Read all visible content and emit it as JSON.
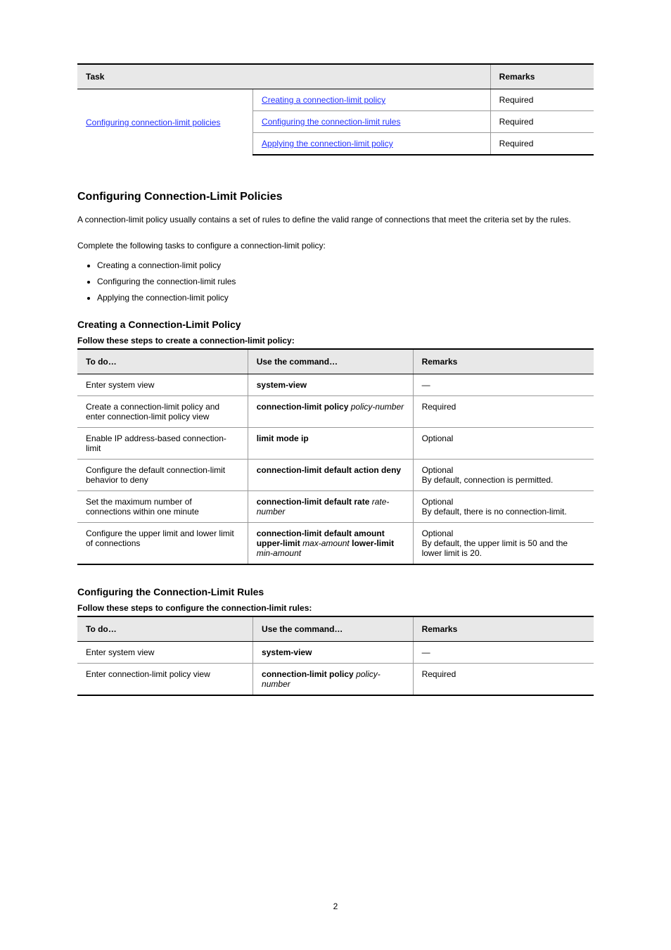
{
  "page_number": "2",
  "table1": {
    "header_left": "Task",
    "header_right": "Remarks",
    "merged_left": "Configuring connection-limit policies",
    "rows": [
      {
        "link": "Creating a connection-limit policy",
        "remarks": "Required"
      },
      {
        "link": "Configuring the connection-limit rules",
        "remarks": "Required"
      },
      {
        "link": "Applying the connection-limit policy",
        "remarks": "Required"
      }
    ]
  },
  "section1": {
    "title": "Configuring Connection-Limit Policies",
    "lead": "A connection-limit policy usually contains a set of rules to define the valid range of connections that meet the criteria set by the rules.",
    "list_intro": "Complete the following tasks to configure a connection-limit policy:",
    "bullets": [
      "Creating a connection-limit policy",
      "Configuring the connection-limit rules",
      "Applying the connection-limit policy"
    ]
  },
  "sub1": {
    "title": "Creating a Connection-Limit Policy",
    "caption": "Follow these steps to create a connection-limit policy:"
  },
  "table2": {
    "headers": [
      "To do…",
      "Use the command…",
      "Remarks"
    ],
    "rows": [
      {
        "c1": "Enter system view",
        "c2": "system-view",
        "c3": "—"
      },
      {
        "c1": "Create a connection-limit policy and enter connection-limit policy view",
        "c2": "connection-limit policy policy-number",
        "c3": "Required"
      },
      {
        "c1": "Enable IP address-based connection-limit",
        "c2": "limit mode ip",
        "c3": "Optional"
      },
      {
        "c1": "Configure the default connection-limit behavior to deny",
        "c2": "connection-limit default action deny",
        "c3": "Optional\nBy default, connection is permitted."
      },
      {
        "c1": "Set the maximum number of connections within one minute",
        "c2": "connection-limit default rate rate-number",
        "c3": "Optional\nBy default, there is no connection-limit."
      },
      {
        "c1": "Configure the upper limit and lower limit of connections",
        "c2": "connection-limit default amount upper-limit max-amount lower-limit min-amount",
        "c3": "Optional\nBy default, the upper limit is 50 and the lower limit is 20."
      }
    ]
  },
  "sub2": {
    "title": "Configuring the Connection-Limit Rules",
    "caption": "Follow these steps to configure the connection-limit rules:"
  },
  "table3": {
    "headers": [
      "To do…",
      "Use the command…",
      "Remarks"
    ],
    "rows": [
      {
        "c1": "Enter system view",
        "c2": "system-view",
        "c3": "—"
      },
      {
        "c1": "Enter connection-limit policy view",
        "c2": "connection-limit policy policy-number",
        "c3": "Required"
      }
    ]
  }
}
